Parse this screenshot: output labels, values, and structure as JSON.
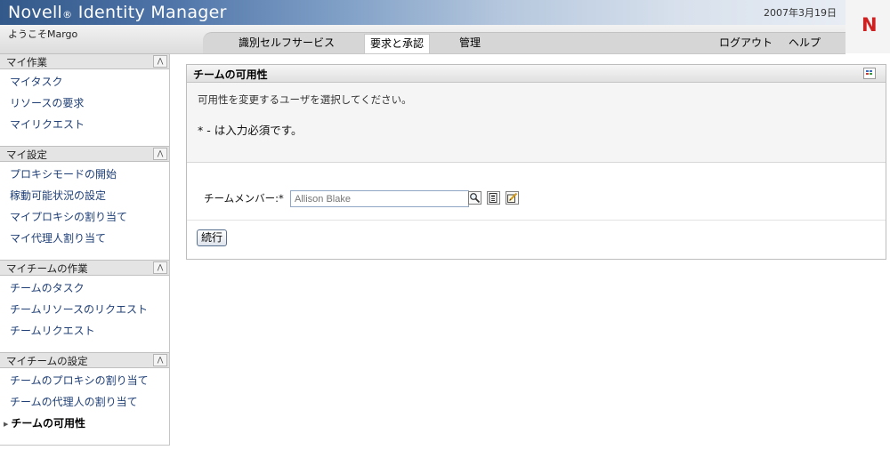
{
  "header": {
    "app_name": "Novell",
    "app_reg": "®",
    "app_product": "Identity Manager",
    "date": "2007年3月19日",
    "welcome": "ようこそMargo",
    "logo_letter": "N",
    "nav_tabs": [
      {
        "label": "識別セルフサービス",
        "active": false
      },
      {
        "label": "要求と承認",
        "active": true
      },
      {
        "label": "管理",
        "active": false
      }
    ],
    "logout": "ログアウト",
    "help": "ヘルプ"
  },
  "sidebar": {
    "sections": [
      {
        "title": "マイ作業",
        "items": [
          "マイタスク",
          "リソースの要求",
          "マイリクエスト"
        ]
      },
      {
        "title": "マイ設定",
        "items": [
          "プロキシモードの開始",
          "稼動可能状況の設定",
          "マイプロキシの割り当て",
          "マイ代理人割り当て"
        ]
      },
      {
        "title": "マイチームの作業",
        "items": [
          "チームのタスク",
          "チームリソースのリクエスト",
          "チームリクエスト"
        ]
      },
      {
        "title": "マイチームの設定",
        "items": [
          "チームのプロキシの割り当て",
          "チームの代理人の割り当て",
          "チームの可用性"
        ]
      }
    ],
    "current_item": "チームの可用性",
    "collapse_glyph": "⋀"
  },
  "panel": {
    "title": "チームの可用性",
    "intro": "可用性を変更するユーザを選択してください。",
    "required_note": "* - は入力必須です。",
    "field_label": "チームメンバー:*",
    "field_placeholder": "Allison Blake",
    "icons": [
      "search-icon",
      "history-icon",
      "edit-icon"
    ],
    "continue_label": "続行"
  },
  "colors": {
    "header_blue": "#33598a",
    "link_blue": "#1f3f76",
    "logo_red": "#d01f1f"
  }
}
